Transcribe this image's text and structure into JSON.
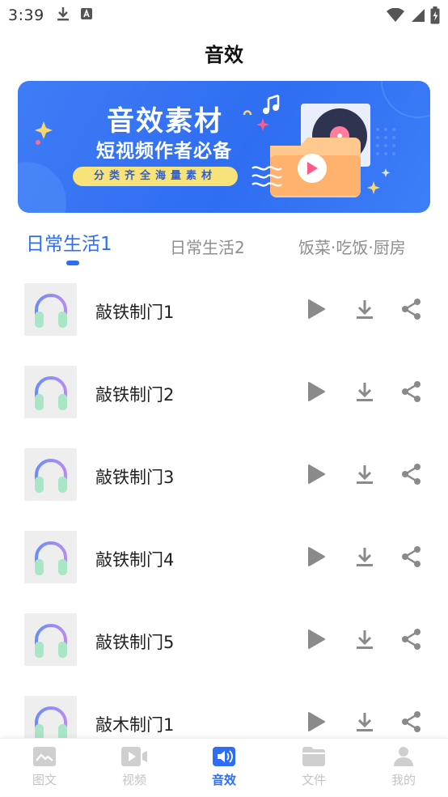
{
  "status": {
    "time": "3:39"
  },
  "page": {
    "title": "音效"
  },
  "banner": {
    "title": "音效素材",
    "subtitle": "短视频作者必备",
    "pill": "分类齐全海量素材"
  },
  "tabs": [
    {
      "label": "日常生活1",
      "active": true
    },
    {
      "label": "日常生活2",
      "active": false
    },
    {
      "label": "饭菜·吃饭·厨房",
      "active": false
    }
  ],
  "sounds": [
    {
      "name": "敲铁制门1"
    },
    {
      "name": "敲铁制门2"
    },
    {
      "name": "敲铁制门3"
    },
    {
      "name": "敲铁制门4"
    },
    {
      "name": "敲铁制门5"
    },
    {
      "name": "敲木制门1"
    }
  ],
  "row_icons": {
    "thumb": "headphones-icon",
    "play": "play-icon",
    "download": "download-icon",
    "share": "share-icon"
  },
  "bottom_nav": [
    {
      "label": "图文",
      "icon": "image-text-icon",
      "active": false
    },
    {
      "label": "视频",
      "icon": "video-icon",
      "active": false
    },
    {
      "label": "音效",
      "icon": "sound-icon",
      "active": true
    },
    {
      "label": "文件",
      "icon": "folder-icon",
      "active": false
    },
    {
      "label": "我的",
      "icon": "user-icon",
      "active": false
    }
  ],
  "colors": {
    "accent": "#2f6df2",
    "inactive": "#c4c4c4",
    "action_icon": "#8a8a8a"
  }
}
